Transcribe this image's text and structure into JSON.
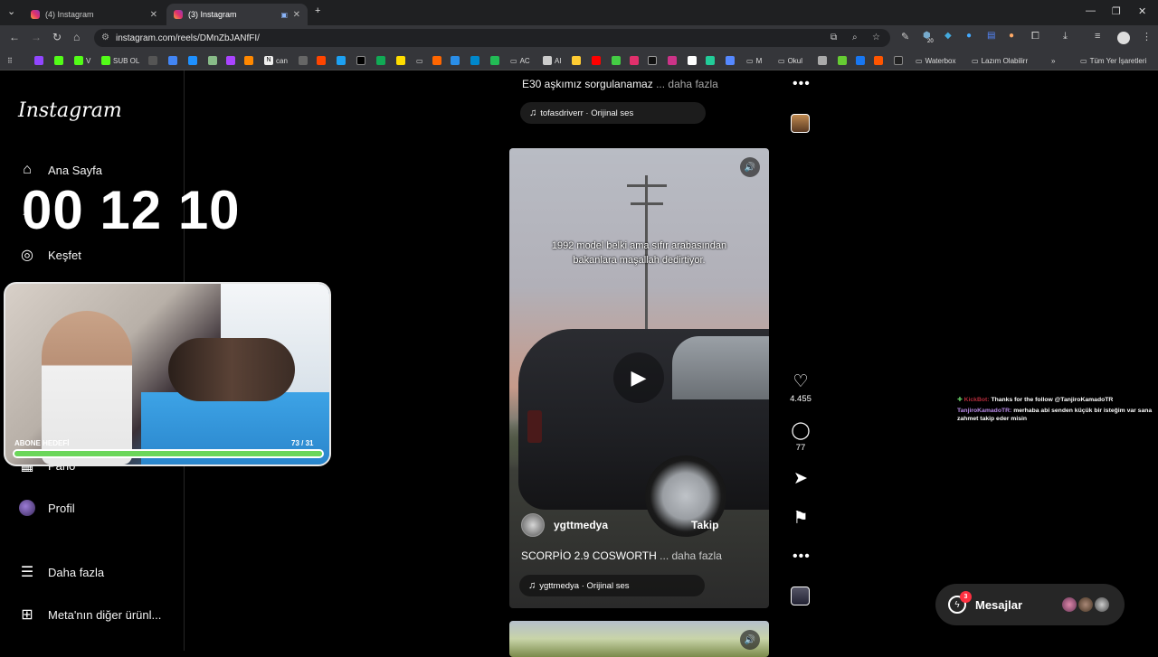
{
  "browser": {
    "tabs": [
      {
        "title": "(4) Instagram",
        "active": false
      },
      {
        "title": "(3) Instagram",
        "active": true
      }
    ],
    "url": "instagram.com/reels/DMnZbJANfFI/",
    "bookmarks": [
      "SUB OL",
      "N",
      "can",
      "AC",
      "AI",
      "M",
      "Okul",
      "Waterbox",
      "Lazım Olabilirr",
      "Tüm Yer İşaretleri"
    ],
    "extension_badge": "20"
  },
  "sidebar": {
    "logo": "Instagram",
    "items": [
      {
        "label": "Ana Sayfa",
        "icon": "home-icon"
      },
      {
        "label": "Keşfet",
        "icon": "compass-icon"
      },
      {
        "label": "Pano",
        "icon": "dashboard-icon"
      },
      {
        "label": "Profil",
        "icon": "avatar"
      },
      {
        "label": "Daha fazla",
        "icon": "menu-icon"
      },
      {
        "label": "Meta'nın diğer ürünl...",
        "icon": "apps-icon"
      }
    ]
  },
  "stream_overlay": {
    "timer": "00 12 10",
    "goal_label": "ABONE HEDEFİ",
    "goal_count": "73 / 31",
    "goal_progress": 1.0
  },
  "feed": {
    "previous_post": {
      "caption": "E30 aşkımız sorgulanamaz",
      "more": "... daha fazla",
      "audio": "tofasdriverr · Orijinal ses"
    },
    "reel": {
      "overlay_text_line1": "1992 model belki ama sıfır arabasından",
      "overlay_text_line2": "bakanlara maşallah dedirtiyor.",
      "author": "ygttmedya",
      "follow": "Takip",
      "caption": "SCORPİO 2.9 COSWORTH",
      "more": "... daha fazla",
      "audio": "ygttmedya · Orijinal ses",
      "likes": "4.455",
      "comments": "77"
    }
  },
  "chat": {
    "messages": [
      {
        "user": "KickBot:",
        "text": "Thanks for the follow @TanjiroKamadoTR"
      },
      {
        "user": "TanjiroKamadoTR:",
        "text": "merhaba abi senden küçük bir isteğim var sana zahmet takip eder misin"
      }
    ]
  },
  "messages_bar": {
    "label": "Mesajlar",
    "badge": "3"
  }
}
